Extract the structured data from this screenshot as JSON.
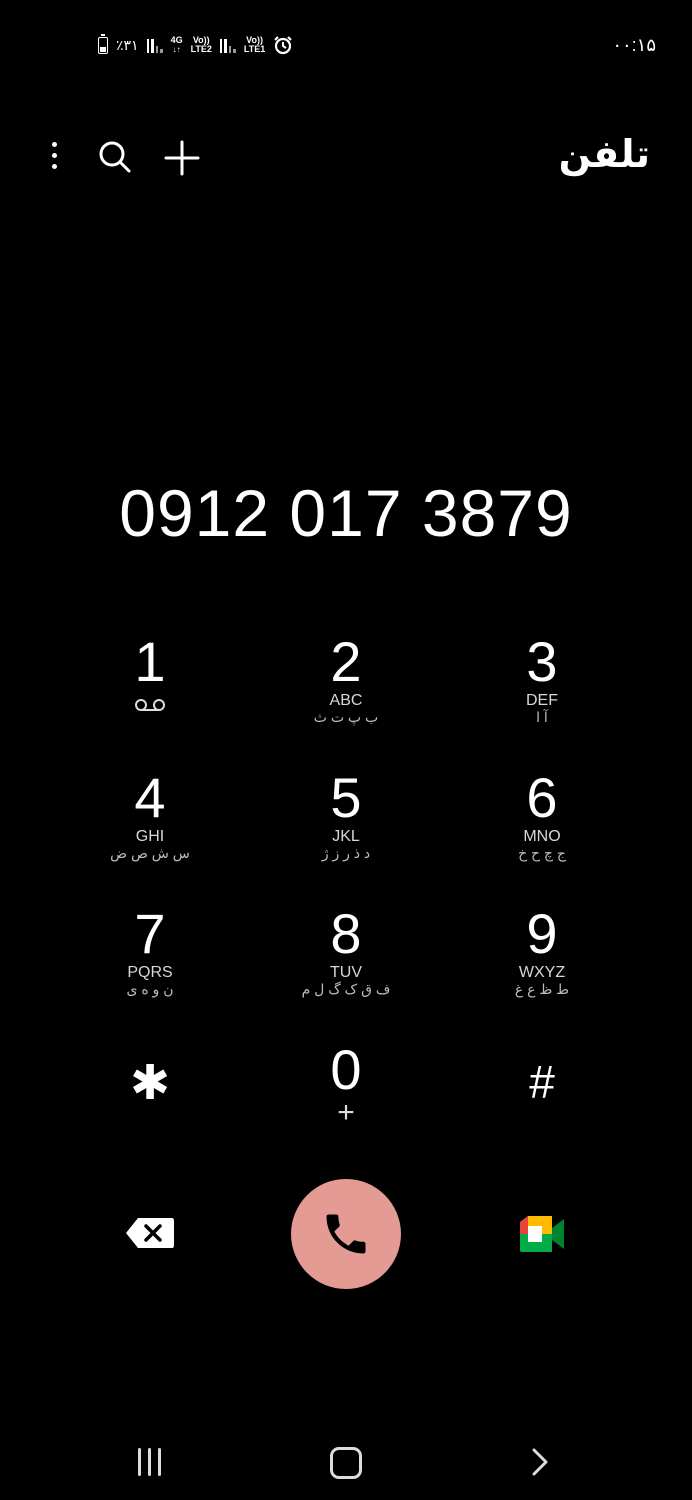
{
  "status_bar": {
    "battery_percent": "٪۳۱",
    "network_type": "4G",
    "volte_label": "Vo))",
    "lte2_label": "LTE2",
    "lte1_label": "LTE1",
    "time": "۰۰:۱۵",
    "icons": [
      "battery-icon",
      "signal-icon",
      "alarm-icon"
    ]
  },
  "app_bar": {
    "title": "تلفن",
    "icons": [
      "more-vert-icon",
      "search-icon",
      "add-icon"
    ]
  },
  "dialer": {
    "entered_number": "0912 017 3879"
  },
  "keypad": {
    "keys": [
      {
        "digit": "1",
        "letters": "",
        "persian": "",
        "sub": ""
      },
      {
        "digit": "2",
        "letters": "ABC",
        "persian": "ب پ ت ث",
        "sub": ""
      },
      {
        "digit": "3",
        "letters": "DEF",
        "persian": "آ ا",
        "sub": ""
      },
      {
        "digit": "4",
        "letters": "GHI",
        "persian": "س ش ص ض",
        "sub": ""
      },
      {
        "digit": "5",
        "letters": "JKL",
        "persian": "د ذ ر ز ژ",
        "sub": ""
      },
      {
        "digit": "6",
        "letters": "MNO",
        "persian": "ج چ ح خ",
        "sub": ""
      },
      {
        "digit": "7",
        "letters": "PQRS",
        "persian": "ن و ه ی",
        "sub": ""
      },
      {
        "digit": "8",
        "letters": "TUV",
        "persian": "ف ق ک گ ل م",
        "sub": ""
      },
      {
        "digit": "9",
        "letters": "WXYZ",
        "persian": "ط ظ ع غ",
        "sub": ""
      },
      {
        "digit": "✱",
        "letters": "",
        "persian": "",
        "sub": ""
      },
      {
        "digit": "0",
        "letters": "",
        "persian": "",
        "sub": "+"
      },
      {
        "digit": "#",
        "letters": "",
        "persian": "",
        "sub": ""
      }
    ]
  },
  "actions": {
    "icons": [
      "backspace-icon",
      "phone-icon",
      "video-call-icon"
    ],
    "call_color": "#e39b94"
  },
  "nav_bar": {
    "icons": [
      "recents-icon",
      "home-icon",
      "back-icon"
    ]
  }
}
